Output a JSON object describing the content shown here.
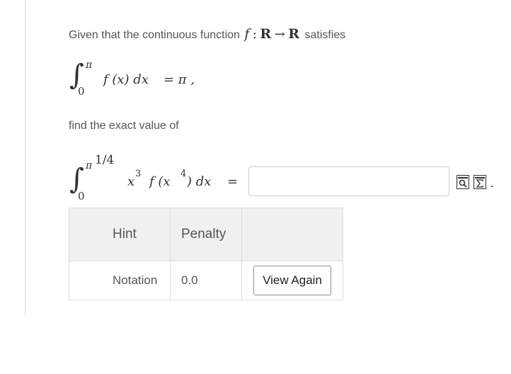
{
  "problem": {
    "intro_prefix": "Given that the continuous function",
    "intro_function": "f",
    "intro_colon": ":",
    "intro_domain": "R",
    "intro_arrow": "→",
    "intro_codomain": "R",
    "intro_suffix": "satisfies",
    "given_integral": {
      "lower": "0",
      "upper": "π",
      "integrand": "f (x) dx",
      "equals": "= π ,"
    },
    "find_text": "find the exact value of",
    "target_integral": {
      "lower": "0",
      "upper_base": "π",
      "upper_exp": "1/4",
      "integrand_coef": "x",
      "integrand_coef_exp": "3",
      "integrand_func": "f (x",
      "integrand_func_exp": "4",
      "integrand_tail": ") dx",
      "equals": "="
    }
  },
  "answer": {
    "value": "",
    "placeholder": ""
  },
  "icons": [
    "preview-icon",
    "equation-editor-icon"
  ],
  "hint_table": {
    "headers": [
      "Hint",
      "Penalty",
      ""
    ],
    "rows": [
      {
        "hint": "Notation",
        "penalty": "0.0",
        "action_label": "View Again"
      }
    ]
  }
}
